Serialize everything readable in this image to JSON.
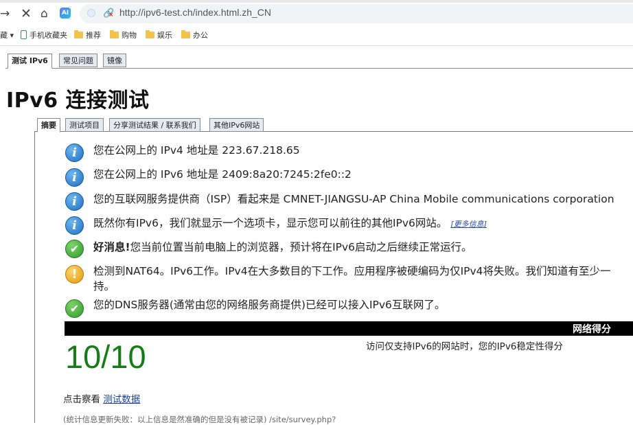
{
  "browser": {
    "url": "http://ipv6-test.ch/index.html.zh_CN",
    "ai_label": "AI",
    "bookmarks": [
      {
        "label": "藏",
        "kind": "text"
      },
      {
        "label": "手机收藏夹",
        "kind": "phone"
      },
      {
        "label": "推荐",
        "kind": "folder"
      },
      {
        "label": "购物",
        "kind": "folder"
      },
      {
        "label": "娱乐",
        "kind": "folder"
      },
      {
        "label": "办公",
        "kind": "folder"
      }
    ]
  },
  "top_tabs": [
    "测试 IPv6",
    "常见问题",
    "镜像"
  ],
  "page_title": "IPv6 连接测试",
  "sub_tabs": [
    "摘要",
    "测试项目",
    "分享测试结果 / 联系我们",
    "其他IPv6网站"
  ],
  "messages": [
    {
      "icon": "info",
      "text": "您在公网上的 IPv4 地址是 223.67.218.65"
    },
    {
      "icon": "info",
      "text": "您在公网上的 IPv6 地址是 2409:8a20:7245:2fe0::2"
    },
    {
      "icon": "info",
      "text": "您的互联网服务提供商（ISP）看起来是 CMNET-JIANGSU-AP China Mobile communications corporation"
    },
    {
      "icon": "info",
      "text": "既然你有IPv6，我们就显示一个选项卡，显示您可以前往的其他IPv6网站。",
      "link": "[更多信息]"
    },
    {
      "icon": "ok",
      "bold": "好消息!",
      "text": "您当前位置当前电脑上的浏览器，预计将在IPv6启动之后继续正常运行。"
    },
    {
      "icon": "warn",
      "text": "检测到NAT64。IPv6工作。IPv4在大多数目的下工作。应用程序被硬编码为仅IPv4将失败。我们知道有至少一",
      "text2": "持。"
    },
    {
      "icon": "ok",
      "text": "您的DNS服务器(通常由您的网络服务商提供)已经可以接入IPv6互联网了。"
    }
  ],
  "score": {
    "header": "网络得分",
    "value": "10/10",
    "description": "访问仅支持IPv6的网站时，您的IPv6稳定性得分"
  },
  "view_data": {
    "prefix": "点击察看 ",
    "link": "测试数据"
  },
  "stats_note": "(统计信息更新失败：以上信息是然准确的但是没有被记录) /site/survey.php?"
}
